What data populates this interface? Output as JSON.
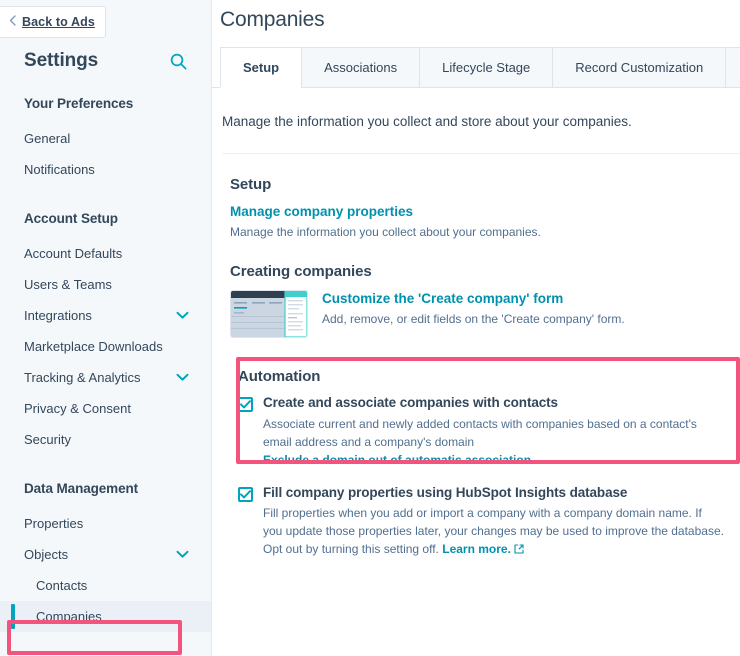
{
  "sidebar": {
    "back_button": {
      "label": "Back to Ads",
      "icon": "chevron-left-icon"
    },
    "title": "Settings",
    "search_icon": "search-icon",
    "sections": [
      {
        "header": "Your Preferences",
        "items": [
          {
            "label": "General",
            "expandable": false,
            "sub": false
          },
          {
            "label": "Notifications",
            "expandable": false,
            "sub": false
          }
        ]
      },
      {
        "header": "Account Setup",
        "items": [
          {
            "label": "Account Defaults",
            "expandable": false,
            "sub": false
          },
          {
            "label": "Users & Teams",
            "expandable": false,
            "sub": false
          },
          {
            "label": "Integrations",
            "expandable": true,
            "sub": false
          },
          {
            "label": "Marketplace Downloads",
            "expandable": false,
            "sub": false
          },
          {
            "label": "Tracking & Analytics",
            "expandable": true,
            "sub": false
          },
          {
            "label": "Privacy & Consent",
            "expandable": false,
            "sub": false
          },
          {
            "label": "Security",
            "expandable": false,
            "sub": false
          }
        ]
      },
      {
        "header": "Data Management",
        "items": [
          {
            "label": "Properties",
            "expandable": false,
            "sub": false
          },
          {
            "label": "Objects",
            "expandable": true,
            "sub": false
          },
          {
            "label": "Contacts",
            "expandable": false,
            "sub": true
          },
          {
            "label": "Companies",
            "expandable": false,
            "sub": true,
            "active": true
          }
        ]
      }
    ]
  },
  "main": {
    "page_title": "Companies",
    "tabs": [
      {
        "label": "Setup",
        "active": true
      },
      {
        "label": "Associations",
        "active": false
      },
      {
        "label": "Lifecycle Stage",
        "active": false
      },
      {
        "label": "Record Customization",
        "active": false
      },
      {
        "label": "",
        "active": false
      }
    ],
    "intro": "Manage the information you collect and store about your companies.",
    "setup": {
      "heading": "Setup",
      "link": "Manage company properties",
      "description": "Manage the information you collect about your companies."
    },
    "creating": {
      "heading": "Creating companies",
      "link": "Customize the 'Create company' form",
      "description": "Add, remove, or edit fields on the 'Create company' form.",
      "thumbnail_icon": "form-preview-thumbnail"
    },
    "automation": {
      "heading": "Automation",
      "options": [
        {
          "checked": true,
          "title": "Create and associate companies with contacts",
          "description": "Associate current and newly added contacts with companies based on a contact's email address and a company's domain",
          "link": "Exclude a domain out of automatic association",
          "link_external": false
        },
        {
          "checked": true,
          "title": "Fill company properties using HubSpot Insights database",
          "description": "Fill properties when you add or import a company with a company domain name. If you update those properties later, your changes may be used to improve the database. Opt out by turning this setting off.",
          "link": "Learn more.",
          "link_external": true,
          "external_icon": "external-link-icon"
        }
      ]
    }
  },
  "annotations": {
    "color": "#f2547d",
    "automation_box": "highlight-automation-section",
    "companies_box": "highlight-sidebar-companies"
  },
  "colors": {
    "accent_teal": "#00a4bd",
    "link_teal": "#0091ae",
    "text_dark": "#33475b",
    "text_muted": "#516f90",
    "sidebar_bg": "#f5f8fa",
    "annotation_pink": "#f2547d"
  }
}
